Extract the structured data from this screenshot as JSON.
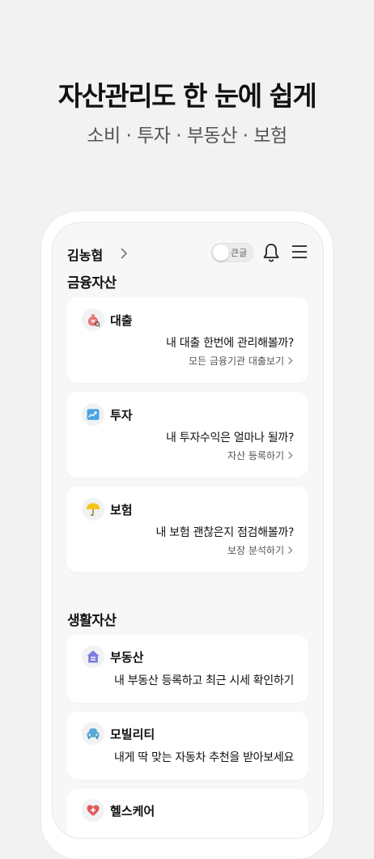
{
  "hero": {
    "title": "자산관리도 한 눈에 쉽게",
    "subtitle": "소비 · 투자 · 부동산 · 보험"
  },
  "header": {
    "user_name": "김농협",
    "toggle_label": "큰글"
  },
  "sections": {
    "financial_title": "금융자산",
    "living_title": "생활자산"
  },
  "cards": {
    "loan": {
      "title": "대출",
      "desc": "내 대출 한번에 관리해볼까?",
      "link": "모든 금융기관 대출보기"
    },
    "invest": {
      "title": "투자",
      "desc": "내 투자수익은 얼마나 될까?",
      "link": "자산 등록하기"
    },
    "insurance": {
      "title": "보험",
      "desc": "내 보험 괜찮은지 점검해볼까?",
      "link": "보장 분석하기"
    },
    "realestate": {
      "title": "부동산",
      "desc": "내 부동산 등록하고 최근 시세 확인하기"
    },
    "mobility": {
      "title": "모빌리티",
      "desc": "내게 딱 맞는 자동차 추천을 받아보세요"
    },
    "healthcare": {
      "title": "헬스케어"
    }
  },
  "colors": {
    "background": "#f2f2f2",
    "card": "#ffffff",
    "loan_icon": "#e8716f",
    "invest_icon": "#4aa3e3",
    "insurance_icon": "#f5c518",
    "realestate_icon": "#7d7be0",
    "mobility_icon": "#5aa8d8",
    "healthcare_icon": "#e05a5a"
  }
}
